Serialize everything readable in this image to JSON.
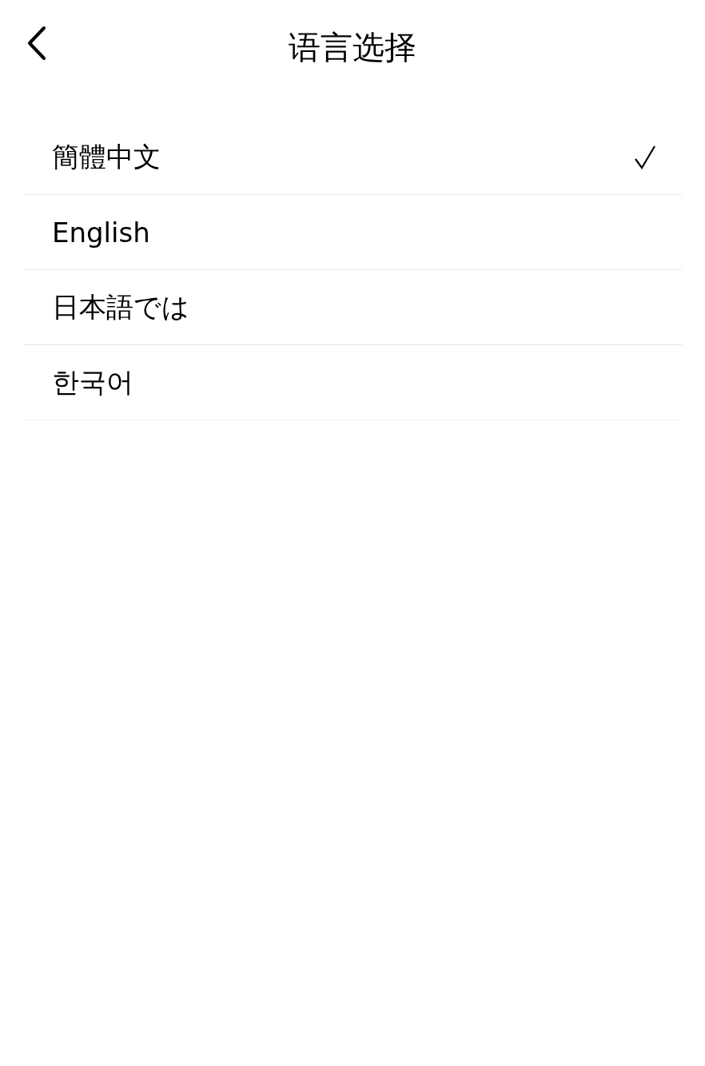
{
  "header": {
    "title": "语言选择"
  },
  "languages": [
    {
      "label": "簡體中文",
      "selected": true
    },
    {
      "label": "English",
      "selected": false
    },
    {
      "label": "日本語では",
      "selected": false
    },
    {
      "label": "한국어",
      "selected": false
    }
  ]
}
